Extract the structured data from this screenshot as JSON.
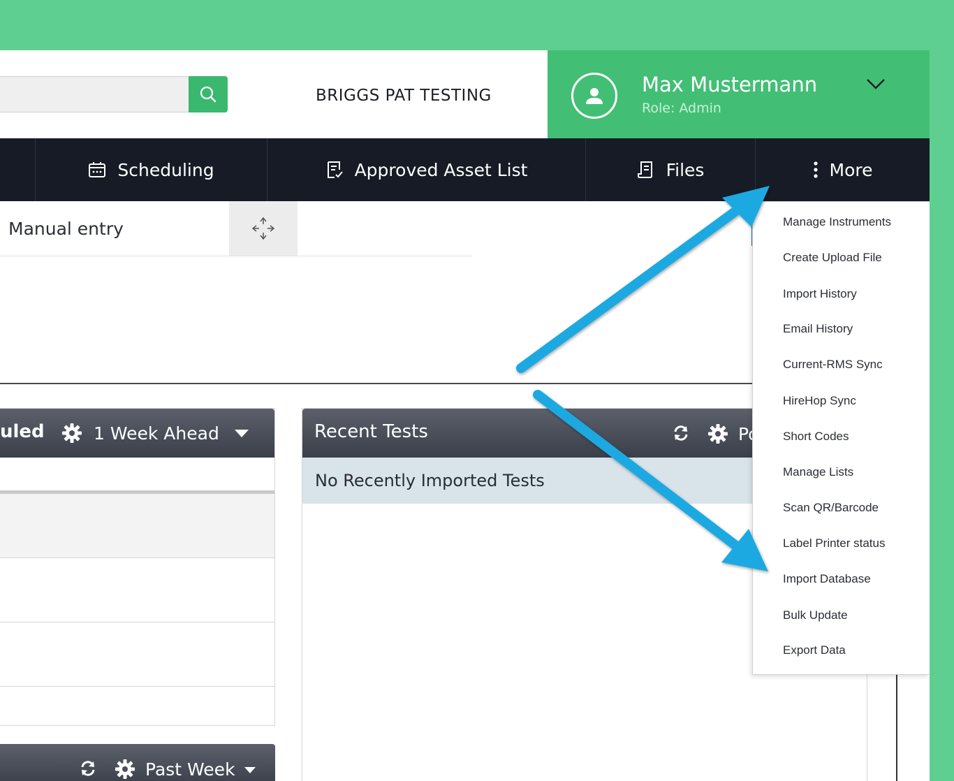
{
  "header": {
    "company": "BRIGGS PAT TESTING",
    "user_name": "Max Mustermann",
    "user_role": "Role: Admin"
  },
  "nav": {
    "scheduling": "Scheduling",
    "approved_asset_list": "Approved Asset List",
    "files": "Files",
    "more": "More"
  },
  "manual_entry": {
    "label": "Manual entry"
  },
  "scheduled_panel": {
    "title_fragment": "uled",
    "range": "1 Week Ahead"
  },
  "past_panel": {
    "range": "Past Week"
  },
  "recent_tests": {
    "title": "Recent Tests",
    "truncated_label": "Po",
    "empty_message": "No Recently Imported Tests"
  },
  "more_menu": {
    "items": [
      "Manage Instruments",
      "Create Upload File",
      "Import History",
      "Email History",
      "Current-RMS Sync",
      "HireHop Sync",
      "Short Codes",
      "Manage Lists",
      "Scan QR/Barcode",
      "Label Printer status",
      "Import Database",
      "Bulk Update",
      "Export Data"
    ]
  },
  "colors": {
    "frame": "#5fcf91",
    "accent_green": "#43bf75",
    "nav_dark": "#161b25",
    "arrow_blue": "#1fa9e1"
  }
}
